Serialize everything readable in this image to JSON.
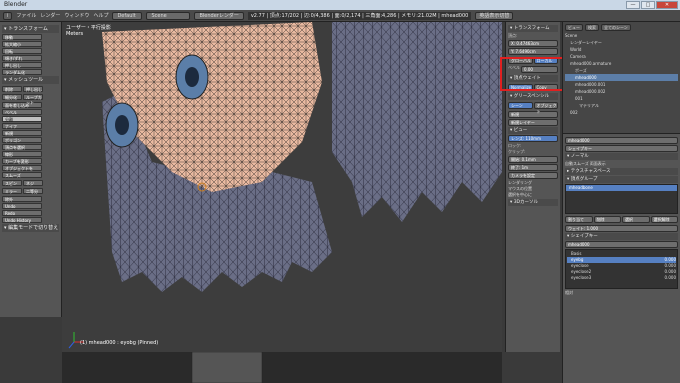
{
  "window": {
    "title": "Blender",
    "min": "—",
    "max": "□",
    "close": "✕"
  },
  "menubar": {
    "editor_btn": "i",
    "menus": [
      "ファイル",
      "レンダー",
      "ウィンドウ",
      "ヘルプ"
    ],
    "layout": "Default",
    "scene": "Scene",
    "engine": "Blenderレンダー",
    "stats": "v2.77 | 頂点:17/202 | 辺:0/4,386 | 面:0/2,174 | 三角面:4,286 | メモリ:21.02M | mhead000",
    "right_btn": "英語表示切替"
  },
  "leftpanel": {
    "sections": [
      {
        "title": "▾ トランスフォーム",
        "items": [
          "移動",
          "拡大縮小",
          "回転",
          "傾き/ずれ",
          "押し出し",
          "ランダム化"
        ]
      },
      {
        "title": "▾ メッシュツール",
        "items": [
          "削除",
          "押し出し",
          "細分化",
          "ループカット",
          "面を差し込み",
          "ベベル",
          "分離",
          "ナイフ",
          "新規",
          "ポリゴン",
          "頂点を選択",
          "線形",
          "カーブを変形",
          "オブジェクトを",
          "スムーズ",
          "スピン",
          "ネジ",
          "ミラー",
          "二等分",
          "除外"
        ]
      },
      {
        "title": "▾ 編集モードで切り替え",
        "items": [
          "Undo",
          "Redo",
          "Undo History"
        ]
      }
    ]
  },
  "viewport": {
    "header": "ユーザー・平行投影",
    "units": "Meters",
    "status": "(1) mhead000 : eyobg (Pinned)",
    "mode": "編集モード",
    "pivot": "グローバル"
  },
  "npanel": {
    "transform_title": "▾ トランスフォーム",
    "location_label": "頂点:",
    "x": "X: 0.47463cm",
    "y": "Y: 7.6490cm",
    "global": "グローバル",
    "local": "ローカル",
    "bevel_label": "ベベル",
    "bevel_value": "0.00",
    "shading_title": "▾ 頂点ウェイト",
    "normal_title": "Normalize",
    "copy": "Copy",
    "grease_title": "▾ グリースペンシル",
    "scene_btn": "シーン",
    "object_btn": "オブジェクト",
    "new_btn": "新規",
    "new_layer": "新規レイヤー",
    "view_title": "▾ ビュー",
    "lens": "レンズ: 110mm",
    "lock_label": "ロック:",
    "clip_title": "クリップ:",
    "clip_start": "開始: 0.1mm",
    "clip_end": "終了: 1m",
    "camera": "カメラを設定",
    "checks": [
      "レンダリング",
      "マウスの位置",
      "選択を中心に"
    ],
    "cursor_title": "▾ 3Dカーソル"
  },
  "outliner": {
    "view": "ビュー",
    "search": "検索",
    "all_scenes": "全てのシーン",
    "items": [
      "Scene",
      "レンダーレイヤー",
      "World",
      "Camera",
      "mhead000.armature",
      "ポーズ",
      "mhead000",
      "mhead000.001",
      "mhead000.002",
      "001",
      "マテリアル",
      "002"
    ]
  },
  "properties": {
    "object_name": "mhead000",
    "shape_title": "シェイプキー",
    "normals": "▾ ノーマル",
    "auto_smooth": "自動スムーズ",
    "double_sided": "両面表示",
    "texture_space": "▸ テクスチャスペース",
    "vgroups": "▾ 頂点グループ",
    "vgroup_item": "mheadbone",
    "assign": "割り当て",
    "remove": "削除",
    "select": "選択",
    "deselect": "選択解除",
    "weight": "ウェイト: 1.000",
    "shapekeys_title": "▾ シェイプキー",
    "sk_object": "mhead000",
    "shapekeys": [
      {
        "name": "Basis",
        "val": ""
      },
      {
        "name": "eyebg",
        "val": "0.000"
      },
      {
        "name": "eyeclose",
        "val": "0.000"
      },
      {
        "name": "eyeclose2",
        "val": "0.000"
      },
      {
        "name": "eyeclose3",
        "val": "0.000"
      }
    ],
    "relative": "相対"
  }
}
